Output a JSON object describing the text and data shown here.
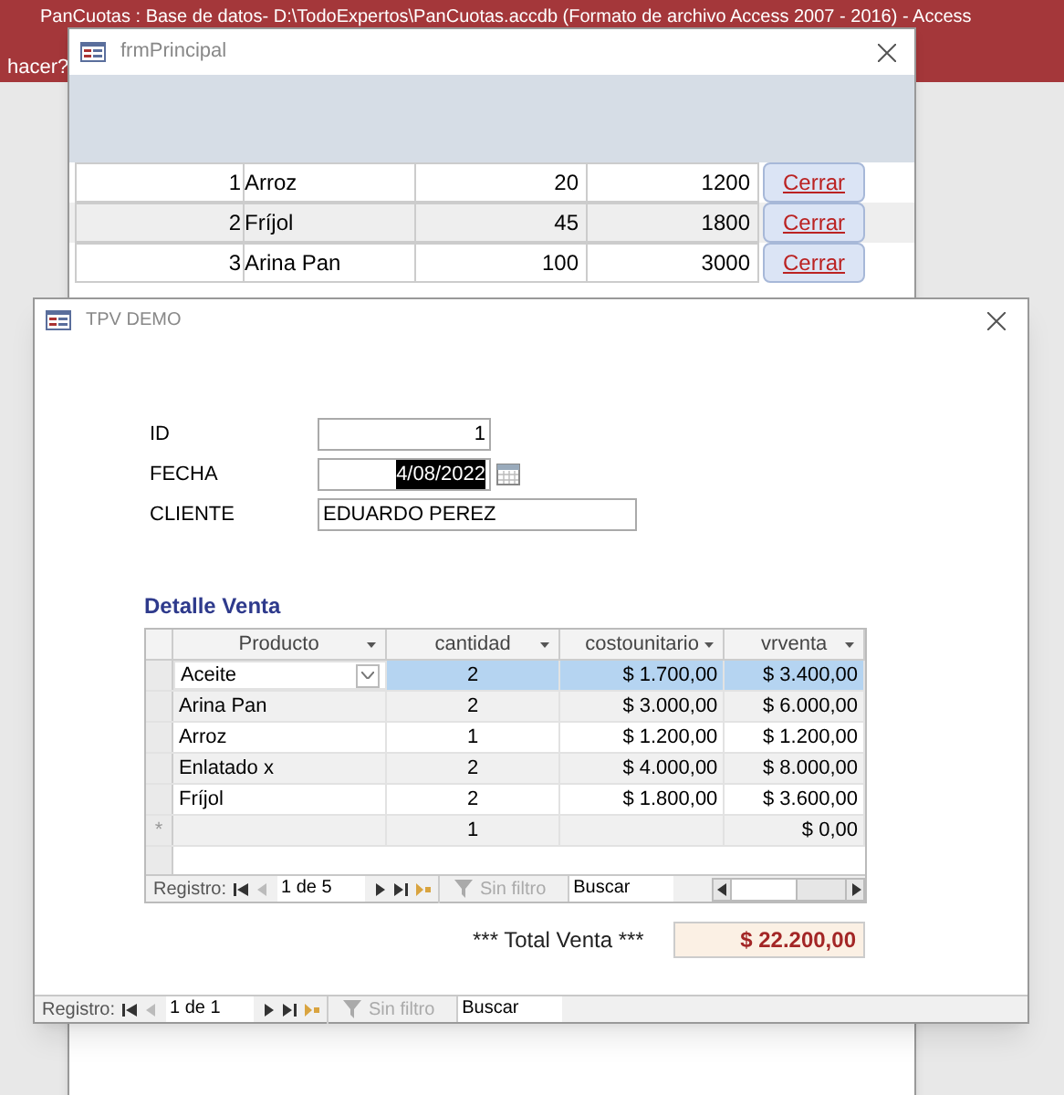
{
  "app": {
    "title": "PanCuotas : Base de datos- D:\\TodoExpertos\\PanCuotas.accdb (Formato de archivo Access 2007 - 2016)  -  Access",
    "ribbon_text": "hacer?"
  },
  "main_form": {
    "title": "frmPrincipal",
    "rows": [
      {
        "id": "1",
        "name": "Arroz",
        "qty": "20",
        "amount": "1200",
        "button": "Cerrar"
      },
      {
        "id": "2",
        "name": "Fríjol",
        "qty": "45",
        "amount": "1800",
        "button": "Cerrar"
      },
      {
        "id": "3",
        "name": "Arina Pan",
        "qty": "100",
        "amount": "3000",
        "button": "Cerrar"
      }
    ]
  },
  "dialog": {
    "title": "TPV DEMO",
    "fields": [
      {
        "label": "ID",
        "value": "1",
        "kind": "number",
        "text_selected": false
      },
      {
        "label": "FECHA",
        "value": "4/08/2022",
        "kind": "date",
        "text_selected": true
      },
      {
        "label": "CLIENTE",
        "value": "EDUARDO PEREZ",
        "kind": "text",
        "text_selected": false
      }
    ],
    "subform": {
      "title": "Detalle Venta",
      "columns": [
        "Producto",
        "cantidad",
        "costounitario",
        "vrventa"
      ],
      "rows": [
        {
          "kind": "record",
          "selected": true,
          "cells": [
            "Aceite",
            "2",
            "$ 1.700,00",
            "$ 3.400,00"
          ]
        },
        {
          "kind": "record",
          "selected": false,
          "cells": [
            "Arina Pan",
            "2",
            "$ 3.000,00",
            "$ 6.000,00"
          ]
        },
        {
          "kind": "record",
          "selected": false,
          "cells": [
            "Arroz",
            "1",
            "$ 1.200,00",
            "$ 1.200,00"
          ]
        },
        {
          "kind": "record",
          "selected": false,
          "cells": [
            "Enlatado x",
            "2",
            "$ 4.000,00",
            "$ 8.000,00"
          ]
        },
        {
          "kind": "record",
          "selected": false,
          "cells": [
            "Fríjol",
            "2",
            "$ 1.800,00",
            "$ 3.600,00"
          ]
        },
        {
          "kind": "new",
          "selected": false,
          "marker": "*",
          "cells": [
            "",
            "1",
            "",
            "$ 0,00"
          ]
        }
      ],
      "nav": {
        "label": "Registro:",
        "position": "1 de 5",
        "filter": "Sin filtro",
        "search": "Buscar"
      }
    },
    "total": {
      "label": "*** Total Venta ***",
      "value": "$ 22.200,00"
    },
    "nav": {
      "label": "Registro:",
      "position": "1 de 1",
      "filter": "Sin filtro",
      "search": "Buscar"
    }
  }
}
